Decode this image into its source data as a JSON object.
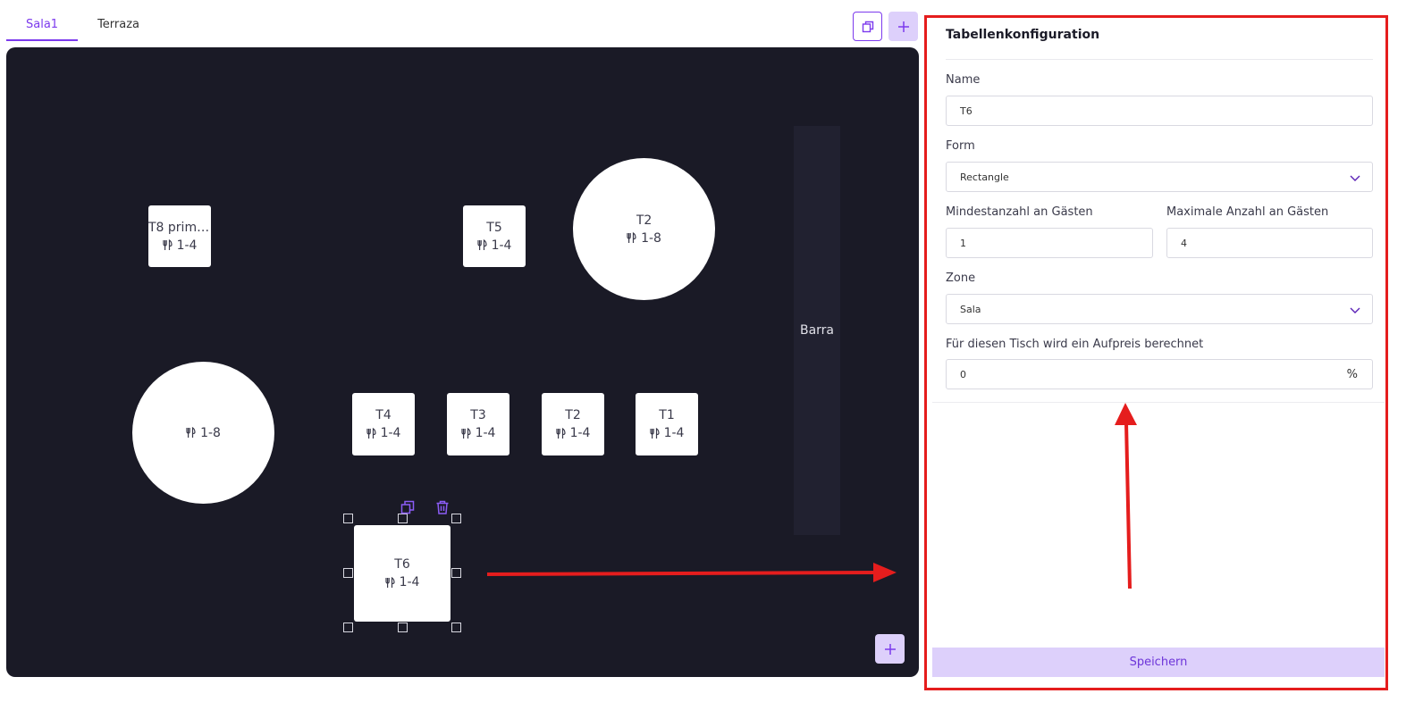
{
  "tabs": [
    {
      "label": "Sala1",
      "active": true
    },
    {
      "label": "Terraza",
      "active": false
    }
  ],
  "toolbar": {
    "copy_icon": "copy-icon",
    "add_icon": "plus-icon"
  },
  "canvas": {
    "tables": [
      {
        "name": "T8 prime...",
        "capacity": "1-4"
      },
      {
        "name": "T5",
        "capacity": "1-4"
      },
      {
        "name": "T2",
        "capacity": "1-8"
      },
      {
        "name": "",
        "capacity": "1-8"
      },
      {
        "name": "T4",
        "capacity": "1-4"
      },
      {
        "name": "T3",
        "capacity": "1-4"
      },
      {
        "name": "T2",
        "capacity": "1-4"
      },
      {
        "name": "T1",
        "capacity": "1-4"
      },
      {
        "name": "T6",
        "capacity": "1-4"
      }
    ],
    "barra_label": "Barra",
    "capacity_icon": "cutlery-icon",
    "selection_icons": [
      "copy-icon",
      "trash-icon"
    ]
  },
  "config": {
    "title": "Tabellenkonfiguration",
    "name_label": "Name",
    "name_value": "T6",
    "form_label": "Form",
    "form_value": "Rectangle",
    "min_label": "Mindestanzahl an Gästen",
    "min_value": "1",
    "max_label": "Maximale Anzahl an Gästen",
    "max_value": "4",
    "zone_label": "Zone",
    "zone_value": "Sala",
    "surcharge_label": "Für diesen Tisch wird ein Aufpreis berechnet",
    "surcharge_value": "0",
    "surcharge_unit": "%",
    "save_label": "Speichern"
  },
  "colors": {
    "accent": "#7c3aed",
    "accent_light": "#ddd0fb",
    "canvas_bg": "#1a1a26",
    "annotation_red": "#e51d1d"
  }
}
